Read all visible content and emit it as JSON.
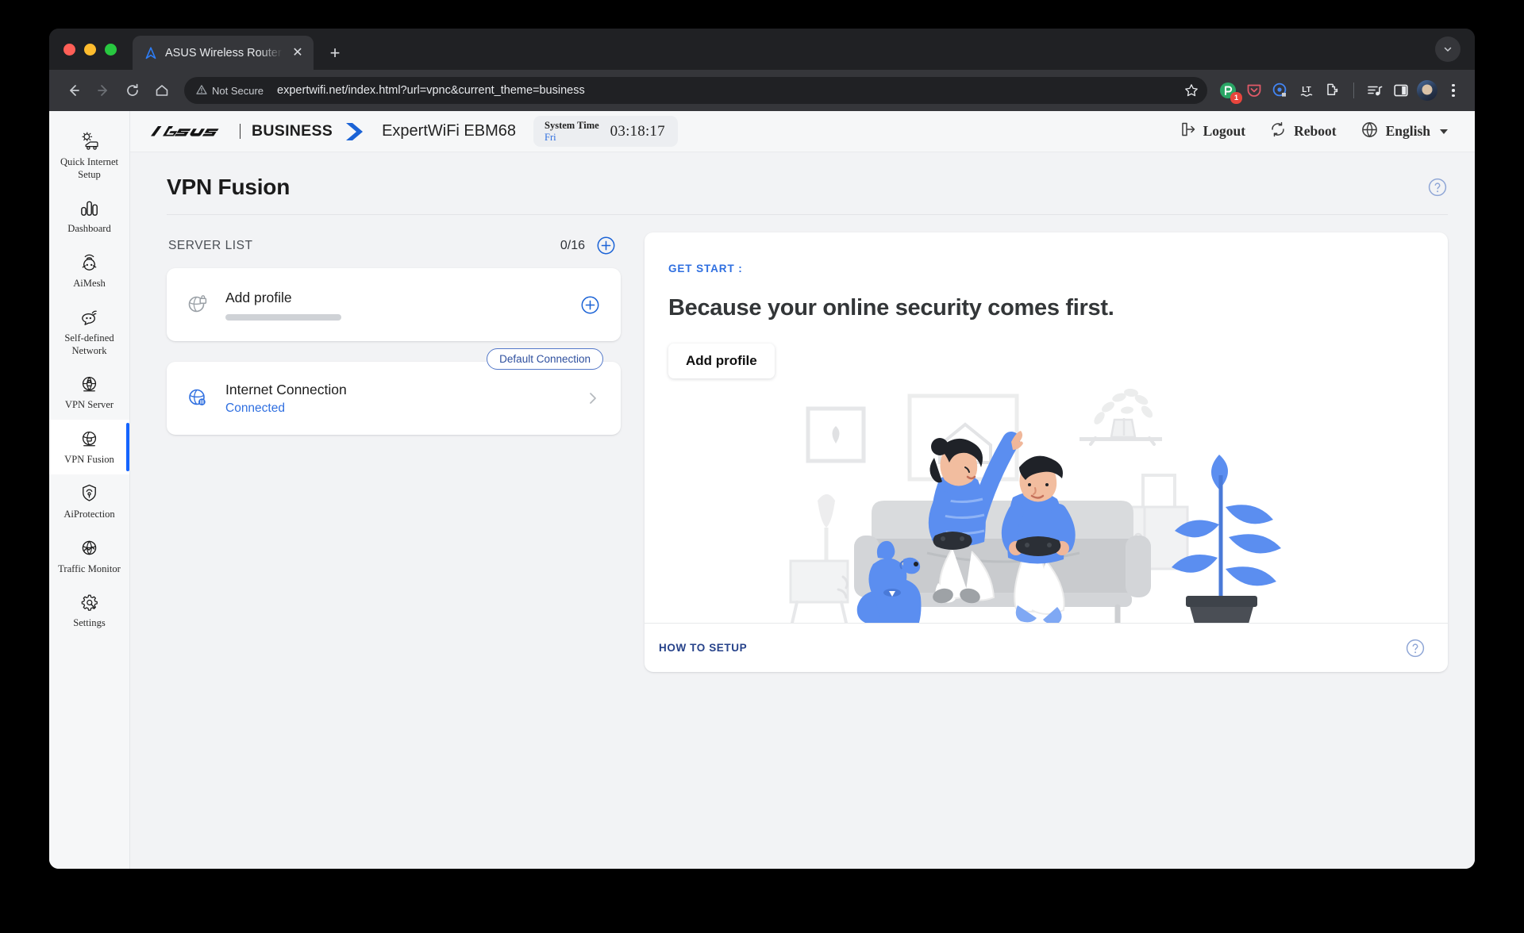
{
  "browser": {
    "tab": {
      "title": "ASUS Wireless Router Expert",
      "favicon_icon": "asus-a-icon",
      "close_icon": "close-icon"
    },
    "new_tab_icon": "plus-icon",
    "tabstrip_menu_icon": "chevron-down-icon",
    "nav": {
      "back_icon": "arrow-left-icon",
      "forward_icon": "arrow-right-icon",
      "reload_icon": "reload-icon",
      "home_icon": "home-icon"
    },
    "omnibox": {
      "security_label": "Not Secure",
      "security_icon": "warning-triangle-icon",
      "url": "expertwifi.net/index.html?url=vpnc&current_theme=business",
      "bookmark_icon": "star-icon"
    },
    "extensions": [
      {
        "name": "grammar-extension-icon",
        "badge": "1",
        "color": "#2aa665"
      },
      {
        "name": "pocket-extension-icon",
        "badge": "",
        "color": "#e05a68"
      },
      {
        "name": "privacy-extension-icon",
        "badge": "",
        "color": "#4285f4"
      },
      {
        "name": "languagetool-extension-icon",
        "badge": "",
        "color": "#e8eaed"
      },
      {
        "name": "puzzle-extensions-icon",
        "badge": "",
        "color": "#e8eaed"
      }
    ],
    "toolbar_right": {
      "playlist_icon": "media-playlist-icon",
      "side_panel_icon": "side-panel-icon",
      "profile_icon": "avatar",
      "menu_icon": "three-dot-menu-icon"
    }
  },
  "app_header": {
    "brand": "ASUS",
    "brand_suffix": "BUSINESS",
    "model": "ExpertWiFi EBM68",
    "system_time": {
      "label": "System Time",
      "day": "Fri",
      "clock": "03:18:17"
    },
    "logout": {
      "label": "Logout",
      "icon": "logout-icon"
    },
    "reboot": {
      "label": "Reboot",
      "icon": "refresh-icon"
    },
    "language": {
      "label": "English",
      "icon": "globe-icon",
      "caret_icon": "caret-down-icon"
    }
  },
  "sidebar": {
    "items": [
      {
        "label": "Quick Internet Setup",
        "icon": "quick-setup-icon",
        "active": false
      },
      {
        "label": "Dashboard",
        "icon": "dashboard-bars-icon",
        "active": false
      },
      {
        "label": "AiMesh",
        "icon": "aimesh-icon",
        "active": false
      },
      {
        "label": "Self-defined Network",
        "icon": "self-defined-network-icon",
        "active": false
      },
      {
        "label": "VPN Server",
        "icon": "vpn-server-icon",
        "active": false
      },
      {
        "label": "VPN Fusion",
        "icon": "vpn-fusion-icon",
        "active": true
      },
      {
        "label": "AiProtection",
        "icon": "shield-icon",
        "active": false
      },
      {
        "label": "Traffic Monitor",
        "icon": "traffic-monitor-icon",
        "active": false
      },
      {
        "label": "Settings",
        "icon": "gear-icon",
        "active": false
      }
    ]
  },
  "main": {
    "page_title": "VPN Fusion",
    "help_icon": "help-circle-icon",
    "server_list": {
      "heading": "SERVER LIST",
      "count": "0/16",
      "add_icon": "plus-circle-icon"
    },
    "profile_card": {
      "title": "Add profile",
      "icon": "globe-lock-icon",
      "add_icon": "plus-circle-icon"
    },
    "connection_card": {
      "title": "Internet Connection",
      "status": "Connected",
      "badge": "Default Connection",
      "icon": "globe-connection-icon",
      "chevron_icon": "chevron-right-icon"
    },
    "promo": {
      "eyebrow": "GET START :",
      "headline": "Because your online security comes first.",
      "button": "Add profile",
      "illustration_name": "people-gaming-on-couch-illustration",
      "footer_link": "HOW TO SETUP",
      "footer_help_icon": "help-circle-icon"
    }
  },
  "colors": {
    "accent_blue": "#1464ff",
    "link_blue": "#2f6fe0",
    "badge_border": "#5579c9",
    "page_bg": "#f2f3f5",
    "browser_chrome": "#35363a"
  }
}
